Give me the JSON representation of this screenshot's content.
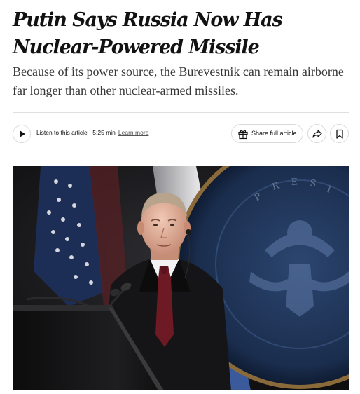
{
  "article": {
    "headline": "Putin Says Russia Now Has Nuclear-Powered Missile",
    "summary": "Because of its power source, the Burevestnik can remain airborne far longer than other nuclear-armed missiles."
  },
  "toolbar": {
    "listen_label": "Listen to this article · 5:25 min",
    "learn_more": "Learn more",
    "share_label": "Share full article",
    "play_icon": "play-icon",
    "gift_icon": "gift-icon",
    "share_icon": "share-arrow-icon",
    "bookmark_icon": "bookmark-icon"
  },
  "colors": {
    "text": "#121212",
    "summary_text": "#363636",
    "border": "#d9d9d9"
  }
}
